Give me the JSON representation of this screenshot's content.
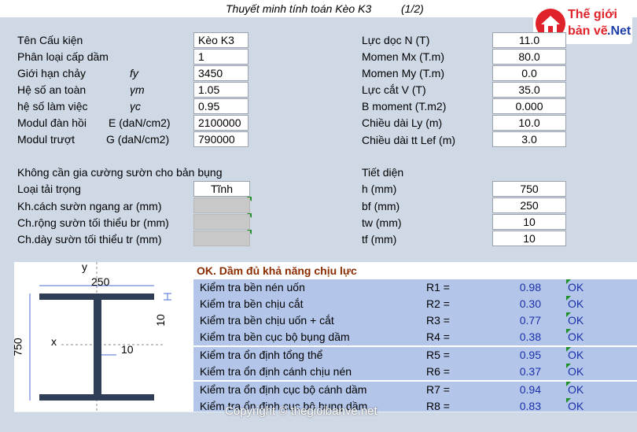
{
  "header": {
    "title": "Thuyết minh tính toán Kèo K3",
    "page": "(1/2)"
  },
  "logo": {
    "line1": "Thế giới",
    "line2": "bản vẽ",
    "suffix": ".Net"
  },
  "left_params": [
    {
      "label": "Tên Cấu kiện",
      "symbol": "",
      "value": "Kèo K3"
    },
    {
      "label": "Phân loại cấp dầm",
      "symbol": "",
      "value": "1"
    },
    {
      "label": "Giới hạn chảy",
      "symbol": "fy",
      "value": "3450"
    },
    {
      "label": "Hệ số an toàn",
      "symbol": "γm",
      "value": "1.05"
    },
    {
      "label": "hệ số làm việc",
      "symbol": "γc",
      "value": "0.95"
    },
    {
      "label": "Modul đàn hồi",
      "symbol": "E (daN/cm2)",
      "value": "2100000"
    },
    {
      "label": "Modul trượt",
      "symbol": "G (daN/cm2)",
      "value": "790000"
    }
  ],
  "right_params": [
    {
      "label": "Lực dọc N (T)",
      "value": "11.0"
    },
    {
      "label": "Momen Mx (T.m)",
      "value": "80.0"
    },
    {
      "label": "Momen My (T.m)",
      "value": "0.0"
    },
    {
      "label": "Lực cắt V (T)",
      "value": "35.0"
    },
    {
      "label": "B moment    (T.m2)",
      "value": "0.000"
    },
    {
      "label": "Chiều dài  Ly (m)",
      "value": "10.0"
    },
    {
      "label": "Chiều dài tt Lef (m)",
      "value": "3.0"
    }
  ],
  "stiffener": {
    "heading": "Không cần gia cường sườn cho bản bụng",
    "load_type_label": "Loại tải trọng",
    "load_type_value": "Tĩnh",
    "rows": [
      {
        "label": "Kh.cách sườn ngang ar (mm)"
      },
      {
        "label": "Ch.rộng sườn tối thiểu br (mm)"
      },
      {
        "label": "Ch.dày sườn tối thiểu tr (mm)"
      }
    ]
  },
  "section": {
    "heading": "Tiết diện",
    "rows": [
      {
        "label": "h (mm)",
        "value": "750"
      },
      {
        "label": "bf (mm)",
        "value": "250"
      },
      {
        "label": "tw (mm)",
        "value": "10"
      },
      {
        "label": "tf (mm)",
        "value": "10"
      }
    ]
  },
  "figure": {
    "y_axis": "y",
    "x_axis": "x",
    "width": "250",
    "height": "750",
    "flange": "10",
    "web": "10"
  },
  "result": {
    "heading": "OK. Dầm đủ khả năng chịu lực"
  },
  "checks": [
    {
      "name": "Kiểm tra bền nén uốn",
      "key": "R1 =",
      "value": "0.98",
      "status": "OK"
    },
    {
      "name": "Kiểm tra bền chịu cắt",
      "key": "R2 =",
      "value": "0.30",
      "status": "OK"
    },
    {
      "name": "Kiểm tra bền chịu uốn + cắt",
      "key": "R3 =",
      "value": "0.77",
      "status": "OK"
    },
    {
      "name": "Kiểm tra bền cục bộ bụng dầm",
      "key": "R4 =",
      "value": "0.38",
      "status": "OK"
    },
    {
      "name": "Kiểm tra ổn định tổng thể",
      "key": "R5 =",
      "value": "0.95",
      "status": "OK"
    },
    {
      "name": "Kiểm tra ổn định cánh chịu nén",
      "key": "R6 =",
      "value": "0.37",
      "status": "OK"
    },
    {
      "name": "Kiểm tra ổn định cục bộ cánh dầm",
      "key": "R7 =",
      "value": "0.94",
      "status": "OK"
    },
    {
      "name": "Kiểm tra ổn định cục bộ bụng dầm",
      "key": "R8 =",
      "value": "0.83",
      "status": "OK"
    }
  ],
  "watermark": "Copyright © thegioibanve.net"
}
